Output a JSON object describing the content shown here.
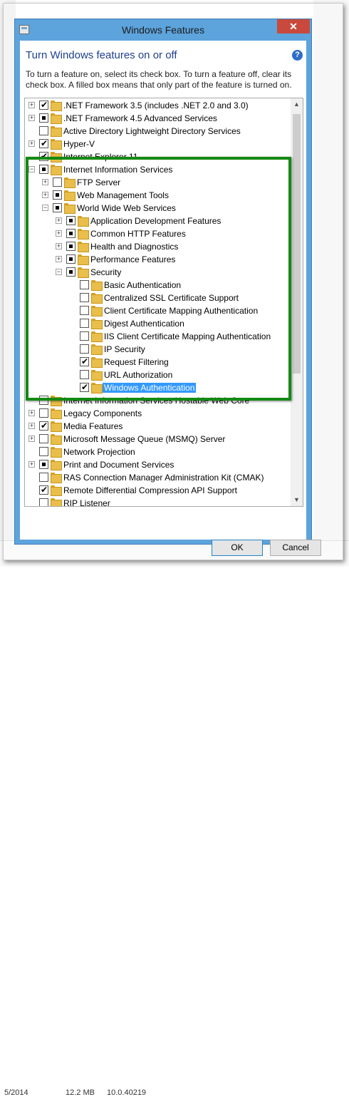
{
  "background": {
    "bottom_row": {
      "date": "5/2014",
      "size": "12.2 MB",
      "version": "10.0.40219"
    }
  },
  "window": {
    "title": "Windows Features",
    "close_glyph": "✕",
    "heading": "Turn Windows features on or off",
    "help_glyph": "?",
    "description": "To turn a feature on, select its check box. To turn a feature off, clear its check box. A filled box means that only part of the feature is turned on."
  },
  "tree": {
    "items": [
      {
        "label": ".NET Framework 3.5 (includes .NET 2.0 and 3.0)",
        "state": "checked",
        "expandable": true,
        "expanded": false,
        "depth": 0
      },
      {
        "label": ".NET Framework 4.5 Advanced Services",
        "state": "partial",
        "expandable": true,
        "expanded": false,
        "depth": 0
      },
      {
        "label": "Active Directory Lightweight Directory Services",
        "state": "unchecked",
        "expandable": false,
        "depth": 0
      },
      {
        "label": "Hyper-V",
        "state": "checked",
        "expandable": true,
        "expanded": false,
        "depth": 0
      },
      {
        "label": "Internet Explorer 11",
        "state": "checked",
        "expandable": false,
        "depth": 0
      },
      {
        "label": "Internet Information Services",
        "state": "partial",
        "expandable": true,
        "expanded": true,
        "depth": 0
      },
      {
        "label": "FTP Server",
        "state": "unchecked",
        "expandable": true,
        "expanded": false,
        "depth": 1
      },
      {
        "label": "Web Management Tools",
        "state": "partial",
        "expandable": true,
        "expanded": false,
        "depth": 1
      },
      {
        "label": "World Wide Web Services",
        "state": "partial",
        "expandable": true,
        "expanded": true,
        "depth": 1
      },
      {
        "label": "Application Development Features",
        "state": "partial",
        "expandable": true,
        "expanded": false,
        "depth": 2
      },
      {
        "label": "Common HTTP Features",
        "state": "partial",
        "expandable": true,
        "expanded": false,
        "depth": 2
      },
      {
        "label": "Health and Diagnostics",
        "state": "partial",
        "expandable": true,
        "expanded": false,
        "depth": 2
      },
      {
        "label": "Performance Features",
        "state": "partial",
        "expandable": true,
        "expanded": false,
        "depth": 2
      },
      {
        "label": "Security",
        "state": "partial",
        "expandable": true,
        "expanded": true,
        "depth": 2
      },
      {
        "label": "Basic Authentication",
        "state": "unchecked",
        "expandable": false,
        "depth": 3
      },
      {
        "label": "Centralized SSL Certificate Support",
        "state": "unchecked",
        "expandable": false,
        "depth": 3
      },
      {
        "label": "Client Certificate Mapping Authentication",
        "state": "unchecked",
        "expandable": false,
        "depth": 3
      },
      {
        "label": "Digest Authentication",
        "state": "unchecked",
        "expandable": false,
        "depth": 3
      },
      {
        "label": "IIS Client Certificate Mapping Authentication",
        "state": "unchecked",
        "expandable": false,
        "depth": 3
      },
      {
        "label": "IP Security",
        "state": "unchecked",
        "expandable": false,
        "depth": 3
      },
      {
        "label": "Request Filtering",
        "state": "checked",
        "expandable": false,
        "depth": 3
      },
      {
        "label": "URL Authorization",
        "state": "unchecked",
        "expandable": false,
        "depth": 3
      },
      {
        "label": "Windows Authentication",
        "state": "checked",
        "expandable": false,
        "depth": 3,
        "selected": true
      },
      {
        "label": "Internet Information Services Hostable Web Core",
        "state": "unchecked",
        "expandable": false,
        "depth": 0
      },
      {
        "label": "Legacy Components",
        "state": "unchecked",
        "expandable": true,
        "expanded": false,
        "depth": 0
      },
      {
        "label": "Media Features",
        "state": "checked",
        "expandable": true,
        "expanded": false,
        "depth": 0
      },
      {
        "label": "Microsoft Message Queue (MSMQ) Server",
        "state": "unchecked",
        "expandable": true,
        "expanded": false,
        "depth": 0
      },
      {
        "label": "Network Projection",
        "state": "unchecked",
        "expandable": false,
        "depth": 0
      },
      {
        "label": "Print and Document Services",
        "state": "partial",
        "expandable": true,
        "expanded": false,
        "depth": 0
      },
      {
        "label": "RAS Connection Manager Administration Kit (CMAK)",
        "state": "unchecked",
        "expandable": false,
        "depth": 0
      },
      {
        "label": "Remote Differential Compression API Support",
        "state": "checked",
        "expandable": false,
        "depth": 0
      },
      {
        "label": "RIP Listener",
        "state": "unchecked",
        "expandable": false,
        "depth": 0
      }
    ]
  },
  "buttons": {
    "ok": "OK",
    "cancel": "Cancel"
  },
  "colors": {
    "highlight_box": "#138a13",
    "selection": "#3399ff",
    "heading": "#1e3f8f"
  }
}
